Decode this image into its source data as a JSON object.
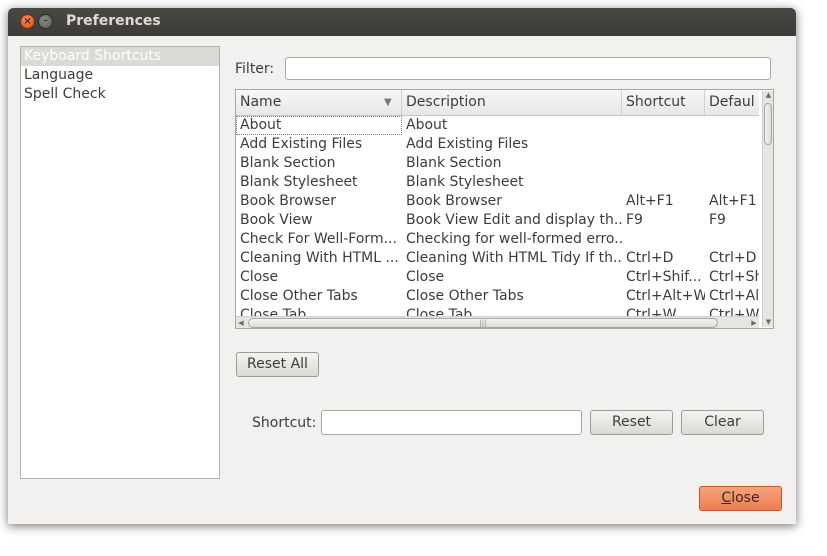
{
  "window": {
    "title": "Preferences",
    "close_icon_glyph": "×",
    "minimize_icon_glyph": "–"
  },
  "sidebar": {
    "items": [
      {
        "label": "Keyboard Shortcuts",
        "selected": true
      },
      {
        "label": "Language",
        "selected": false
      },
      {
        "label": "Spell Check",
        "selected": false
      }
    ]
  },
  "filter": {
    "label": "Filter:",
    "value": ""
  },
  "table": {
    "columns": [
      "Name",
      "Description",
      "Shortcut",
      "Defaul"
    ],
    "sort_icon": "▼",
    "rows": [
      [
        "About",
        "About",
        "",
        ""
      ],
      [
        "Add Existing Files",
        "Add Existing Files",
        "",
        ""
      ],
      [
        "Blank Section",
        "Blank Section",
        "",
        ""
      ],
      [
        "Blank Stylesheet",
        "Blank Stylesheet",
        "",
        ""
      ],
      [
        "Book Browser",
        "Book Browser",
        "Alt+F1",
        "Alt+F1"
      ],
      [
        "Book View",
        "Book View Edit and display th...",
        "F9",
        "F9"
      ],
      [
        "Check For Well-Form...",
        "Checking for well-formed erro...",
        "",
        ""
      ],
      [
        "Cleaning With HTML ...",
        "Cleaning With HTML Tidy If th...",
        "Ctrl+D",
        "Ctrl+D"
      ],
      [
        "Close",
        "Close",
        "Ctrl+Shif...",
        "Ctrl+Sh"
      ],
      [
        "Close Other Tabs",
        "Close Other Tabs",
        "Ctrl+Alt+W",
        "Ctrl+Al"
      ],
      [
        "Close Tab",
        "Close Tab",
        "Ctrl+W",
        "Ctrl+W"
      ]
    ]
  },
  "scroll": {
    "up": "▲",
    "down": "▼",
    "left": "◀",
    "right": "▶",
    "grip": "|||"
  },
  "buttons": {
    "reset_all": "Reset All",
    "reset": "Reset",
    "clear": "Clear",
    "close_mnemonic": "C",
    "close_rest": "lose"
  },
  "shortcut": {
    "label": "Shortcut:",
    "value": ""
  },
  "colors": {
    "titlebar": "#3c3b37",
    "close_accent": "#ee7d52",
    "selection": "#dcdad5"
  }
}
